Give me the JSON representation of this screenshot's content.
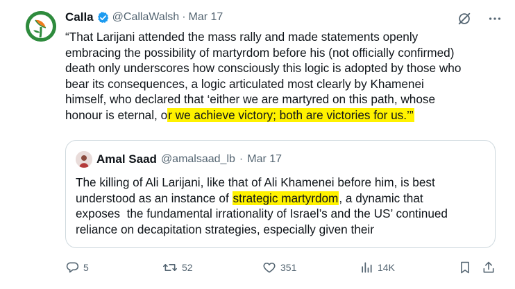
{
  "author": {
    "name": "Calla",
    "handle": "@CallaWalsh",
    "separator": "·",
    "date": "Mar 17",
    "verified": true,
    "avatar_icon": "calla-lily-logo-icon"
  },
  "body": {
    "lines": [
      "“That Larijani attended the mass rally and made statements openly",
      "embracing the possibility of martyrdom before his (not officially confirmed)",
      "death only underscores how consciously this logic is adopted by those who",
      "bear its consequences, a logic articulated most clearly by Khamenei",
      "himself, who declared that ‘either we are martyred on this path, whose"
    ],
    "last_line_before": "honour is eternal, o",
    "last_line_highlight": "r we achieve victory; both are victories for us.’”"
  },
  "quote": {
    "name": "Amal Saad",
    "handle": "@amalsaad_lb",
    "separator": "·",
    "date": "Mar 17",
    "line1": "The killing of Ali Larijani, like that of Ali Khamenei before him, is best",
    "line2_before": "understood as an instance of ",
    "line2_highlight": "strategic martyrdom",
    "line2_after": ", a dynamic that",
    "line3": "exposes  the fundamental irrationality of Israel’s and the US’ continued",
    "line4": "reliance on decapitation strategies, especially given their"
  },
  "actions": {
    "replies": "5",
    "reposts": "52",
    "likes": "351",
    "views": "14K"
  },
  "colors": {
    "text": "#0f1419",
    "muted": "#536471",
    "verified": "#1d9bf0",
    "highlight": "#fff200",
    "border": "#cfd9de",
    "avatar_green": "#2e8b3d"
  }
}
